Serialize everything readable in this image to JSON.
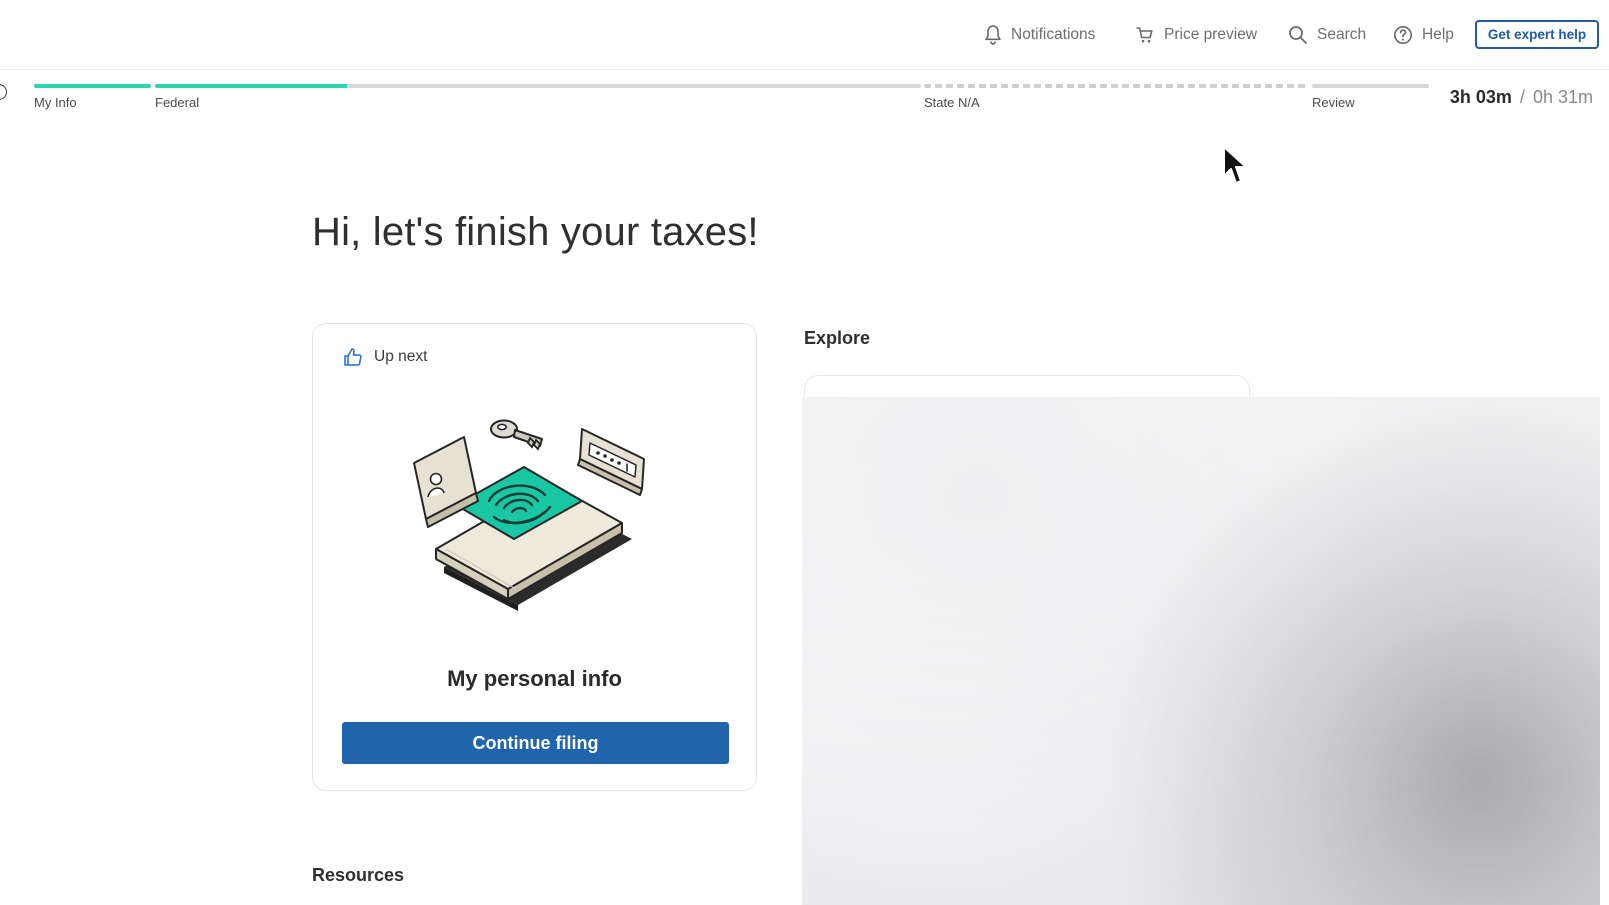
{
  "header": {
    "notifications_label": "Notifications",
    "price_preview_label": "Price preview",
    "search_label": "Search",
    "help_label": "Help",
    "expert_help_label": "Get expert help"
  },
  "progress": {
    "steps": [
      {
        "label": "My Info",
        "completion": 1.0
      },
      {
        "label": "Federal",
        "completion": 0.25
      },
      {
        "label": "State N/A",
        "completion": 0
      },
      {
        "label": "Review",
        "completion": 0
      }
    ],
    "time_spent": "3h 03m",
    "time_separator": "/",
    "time_remaining": "0h 31m"
  },
  "main": {
    "greeting": "Hi, let's finish your taxes!",
    "up_next": {
      "label": "Up next",
      "title": "My personal info",
      "button_label": "Continue filing"
    },
    "explore_heading": "Explore",
    "resources_heading": "Resources"
  },
  "colors": {
    "accent_blue": "#1f64ad",
    "progress_fill": "#2ed3b4",
    "track": "#d6d6d6",
    "text_dark": "#2b2b2b"
  },
  "icons": {
    "notifications": "bell-icon",
    "price_preview": "cart-icon",
    "search": "search-icon",
    "help": "help-icon",
    "up_next": "thumbs-up-icon"
  }
}
